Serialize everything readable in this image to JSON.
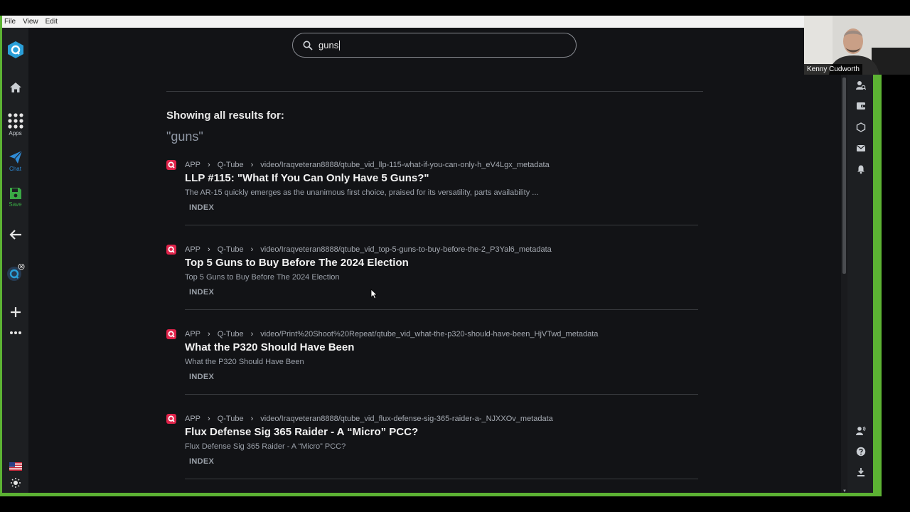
{
  "menu": [
    "File",
    "View",
    "Edit"
  ],
  "leftbar": {
    "apps_label": "Apps",
    "chat_label": "Chat",
    "save_label": "Save"
  },
  "search": {
    "value": "guns"
  },
  "results_header": {
    "showing": "Showing all results for:",
    "query": "\"guns\""
  },
  "results": [
    {
      "source": "APP",
      "app": "Q-Tube",
      "path": "video/Iraqveteran8888/qtube_vid_llp-115-what-if-you-can-only-h_eV4Lgx_metadata",
      "title": "LLP #115: \"What If You Can Only Have 5 Guns?\"",
      "description": "The AR-15 quickly emerges as the unanimous first choice, praised for its versatility, parts availability ...",
      "tag": "INDEX"
    },
    {
      "source": "APP",
      "app": "Q-Tube",
      "path": "video/Iraqveteran8888/qtube_vid_top-5-guns-to-buy-before-the-2_P3Yal6_metadata",
      "title": "Top 5 Guns to Buy Before The 2024 Election",
      "description": "Top 5 Guns to Buy Before The 2024 Election",
      "tag": "INDEX"
    },
    {
      "source": "APP",
      "app": "Q-Tube",
      "path": "video/Print%20Shoot%20Repeat/qtube_vid_what-the-p320-should-have-been_HjVTwd_metadata",
      "title": "What the P320 Should Have Been",
      "description": "What the P320 Should Have Been",
      "tag": "INDEX"
    },
    {
      "source": "APP",
      "app": "Q-Tube",
      "path": "video/Iraqveteran8888/qtube_vid_flux-defense-sig-365-raider-a-_NJXXOv_metadata",
      "title": "Flux Defense Sig 365 Raider - A “Micro” PCC?",
      "description": "Flux Defense Sig 365 Raider - A “Micro” PCC?",
      "tag": "INDEX"
    }
  ],
  "webcam": {
    "name": "Kenny Cudworth"
  },
  "colors": {
    "frame_green": "#5cb233",
    "background": "#121316",
    "chat_blue": "#2f8bd6",
    "save_green": "#3aa845",
    "result_icon_red": "#e0234a"
  }
}
